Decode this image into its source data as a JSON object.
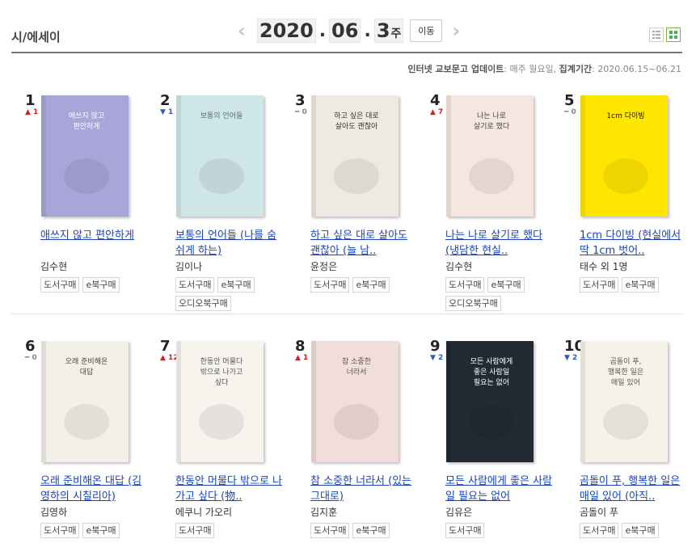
{
  "category": "시/에세이",
  "week": {
    "prev": "‹",
    "next": "›",
    "year": "2020",
    "month": "06",
    "week_num": "3",
    "week_suffix": "주",
    "go_label": "이동"
  },
  "update": {
    "prefix": "인터넷 교보문고 업데이트",
    "schedule": ": 매주 월요일,",
    "period_label": "집계기간",
    "period": ": 2020.06.15~06.21"
  },
  "books": [
    {
      "rank": "1",
      "change": "▲ 1",
      "dir": "up",
      "title": "애쓰지 않고 편안하게",
      "author": "김수현",
      "buttons": [
        "도서구매",
        "e북구매"
      ]
    },
    {
      "rank": "2",
      "change": "▼ 1",
      "dir": "down",
      "title": "보통의 언어들 (나를 숨 쉬게 하는)",
      "author": "김이나",
      "buttons": [
        "도서구매",
        "e북구매",
        "오디오북구매"
      ]
    },
    {
      "rank": "3",
      "change": "━ 0",
      "dir": "same",
      "title": "하고 싶은 대로 살아도 괜찮아 (늘 남..",
      "author": "윤정은",
      "buttons": [
        "도서구매",
        "e북구매"
      ]
    },
    {
      "rank": "4",
      "change": "▲ 7",
      "dir": "up",
      "title": "나는 나로 살기로 했다 (냉담한 현실..",
      "author": "김수현",
      "buttons": [
        "도서구매",
        "e북구매",
        "오디오북구매"
      ]
    },
    {
      "rank": "5",
      "change": "━ 0",
      "dir": "same",
      "title": "1cm 다이빙 (현실에서 딱 1cm 벗어..",
      "author": "태수 외 1명",
      "buttons": [
        "도서구매",
        "e북구매"
      ]
    },
    {
      "rank": "6",
      "change": "━ 0",
      "dir": "same",
      "title": "오래 준비해온 대답 (김영하의 시칠리아)",
      "author": "김영하",
      "buttons": [
        "도서구매",
        "e북구매"
      ]
    },
    {
      "rank": "7",
      "change": "▲ 12",
      "dir": "up",
      "title": "한동안 머물다 밖으로 나가고 싶다 (物..",
      "author": "에쿠니 가오리",
      "buttons": [
        "도서구매"
      ]
    },
    {
      "rank": "8",
      "change": "▲ 1",
      "dir": "up",
      "title": "참 소중한 너라서 (있는 그대로)",
      "author": "김지훈",
      "buttons": [
        "도서구매",
        "e북구매"
      ]
    },
    {
      "rank": "9",
      "change": "▼ 2",
      "dir": "down",
      "title": "모든 사람에게 좋은 사람일 필요는 없어",
      "author": "김유은",
      "buttons": [
        "도서구매"
      ]
    },
    {
      "rank": "10",
      "change": "▼ 2",
      "dir": "down",
      "title": "곰돌이 푸, 행복한 일은 매일 있어 (아직..",
      "author": "곰돌이 푸",
      "buttons": [
        "도서구매",
        "e북구매"
      ]
    }
  ],
  "covers": [
    {
      "bg": "#a8a6d8",
      "text": "애쓰지 않고 편안하게",
      "text_color": "#ffffff"
    },
    {
      "bg": "#cfe6e6",
      "text": "보통의 언어들",
      "text_color": "#5a6d7a"
    },
    {
      "bg": "#eeeae2",
      "text": "하고 싶은 대로 살아도 괜찮아",
      "text_color": "#333333"
    },
    {
      "bg": "#f6e6e0",
      "text": "나는 나로 살기로 했다",
      "text_color": "#444444"
    },
    {
      "bg": "#ffe600",
      "text": "1cm 다이빙",
      "text_color": "#111111"
    },
    {
      "bg": "#f3f0e8",
      "text": "오래 준비해온 대답",
      "text_color": "#444444"
    },
    {
      "bg": "#f7f4ee",
      "text": "한동안 머물다 밖으로 나가고 싶다",
      "text_color": "#555555"
    },
    {
      "bg": "#f1ddda",
      "text": "참 소중한 너라서",
      "text_color": "#555555"
    },
    {
      "bg": "#222a33",
      "text": "모든 사람에게 좋은 사람일 필요는 없어",
      "text_color": "#ffffff"
    },
    {
      "bg": "#f6f2e8",
      "text": "곰돌이 푸, 행복한 일은 매일 있어",
      "text_color": "#555555"
    }
  ]
}
